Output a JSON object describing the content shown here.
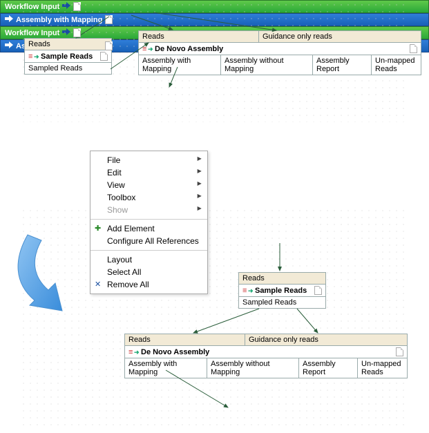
{
  "workflow_input": "Workflow Input",
  "reads": "Reads",
  "sample_reads": "Sample Reads",
  "sampled_reads": "Sampled Reads",
  "guidance_only_reads": "Guidance only reads",
  "de_novo_assembly": "De Novo Assembly",
  "assembly_with_mapping": "Assembly with Mapping",
  "assembly_without_mapping": "Assembly without Mapping",
  "assembly_report": "Assembly Report",
  "unmapped_reads": "Un-mapped Reads",
  "output_assembly_with_mapping": "Assembly with Mapping",
  "menu": {
    "file": "File",
    "edit": "Edit",
    "view": "View",
    "toolbox": "Toolbox",
    "show": "Show",
    "add_element": "Add Element",
    "configure_all": "Configure All References",
    "layout": "Layout",
    "select_all": "Select All",
    "remove_all": "Remove All"
  }
}
